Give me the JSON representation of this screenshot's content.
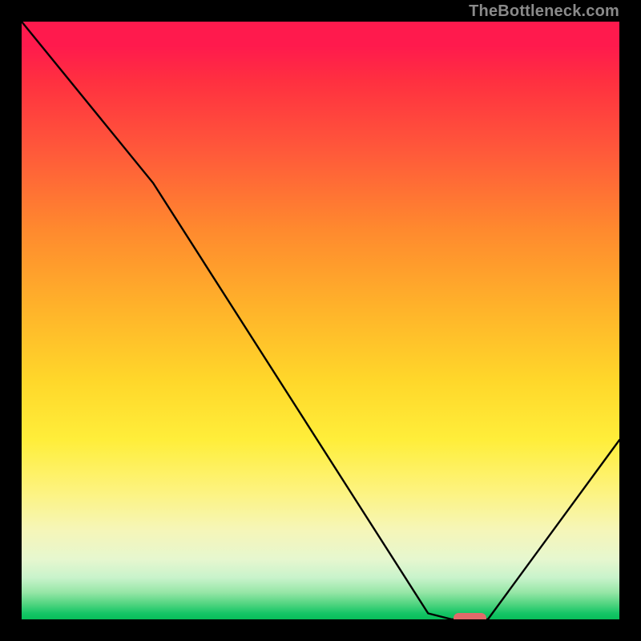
{
  "watermark": "TheBottleneck.com",
  "chart_data": {
    "type": "line",
    "title": "",
    "xlabel": "",
    "ylabel": "",
    "xlim": [
      0,
      100
    ],
    "ylim": [
      0,
      100
    ],
    "x": [
      0,
      22,
      68,
      72,
      78,
      100
    ],
    "values": [
      100,
      73,
      1,
      0,
      0,
      30
    ],
    "optimum_marker": {
      "x_center": 75,
      "y": 0,
      "width_pct": 5.6
    },
    "background": "vertical-gradient red→orange→yellow→green",
    "grid": false
  }
}
